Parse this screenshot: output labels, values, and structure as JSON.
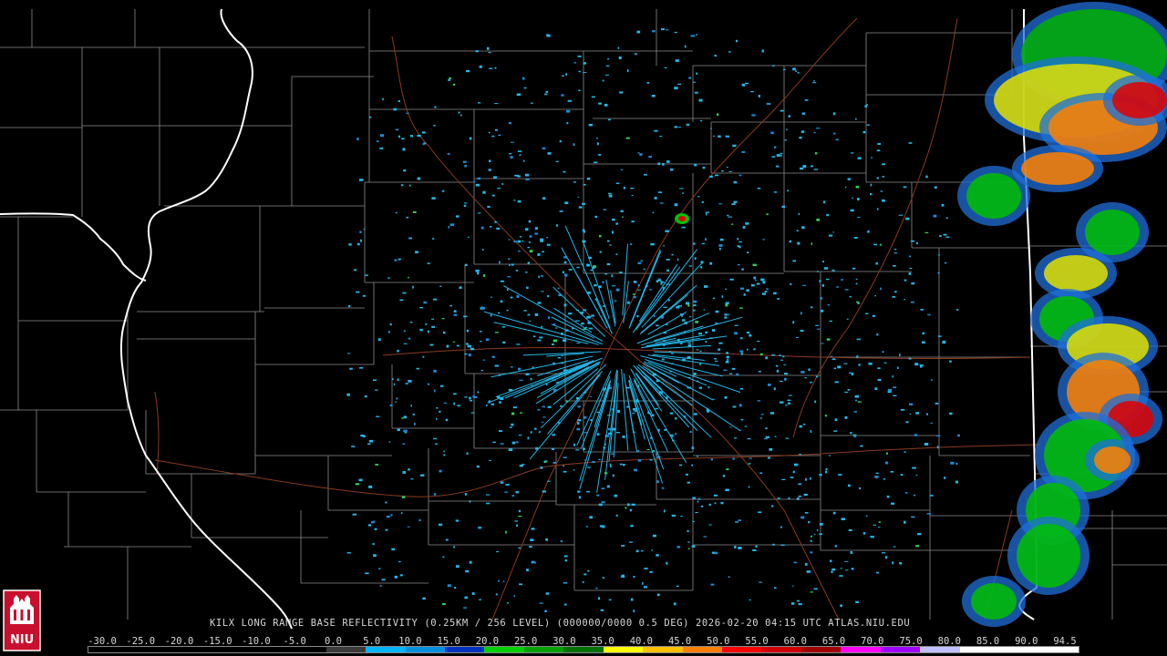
{
  "title": "KILX LONG RANGE BASE REFLECTIVITY (0.25KM / 256 LEVEL) (000000/0000 0.5 DEG) 2026-02-20 04:15 UTC  ATLAS.NIU.EDU",
  "logo": {
    "text": "NIU",
    "icon": "niu-logo-icon"
  },
  "scale": {
    "labels": [
      "-30.0",
      "-25.0",
      "-20.0",
      "-15.0",
      "-10.0",
      "-5.0",
      "0.0",
      "5.0",
      "10.0",
      "15.0",
      "20.0",
      "25.0",
      "30.0",
      "35.0",
      "40.0",
      "45.0",
      "50.0",
      "55.0",
      "60.0",
      "65.0",
      "70.0",
      "75.0",
      "80.0",
      "85.0",
      "90.0",
      "94.5"
    ],
    "colors": [
      "#000000",
      "#000000",
      "#000000",
      "#000000",
      "#000000",
      "#000000",
      "#3a3a3a",
      "#00b4ff",
      "#0090e0",
      "#0030c0",
      "#00d000",
      "#00a000",
      "#007000",
      "#ffff00",
      "#ffc000",
      "#ff8000",
      "#ff0000",
      "#d00000",
      "#a00000",
      "#ff00ff",
      "#a000ff",
      "#c0c0ff",
      "#ffffff",
      "#ffffff",
      "#ffffff"
    ]
  },
  "colors": {
    "background": "#000000",
    "county_lines": "#8a8a8a",
    "state_lines": "#ffffff",
    "roads": "#8b3a20",
    "clutter": "#23b7e8"
  }
}
